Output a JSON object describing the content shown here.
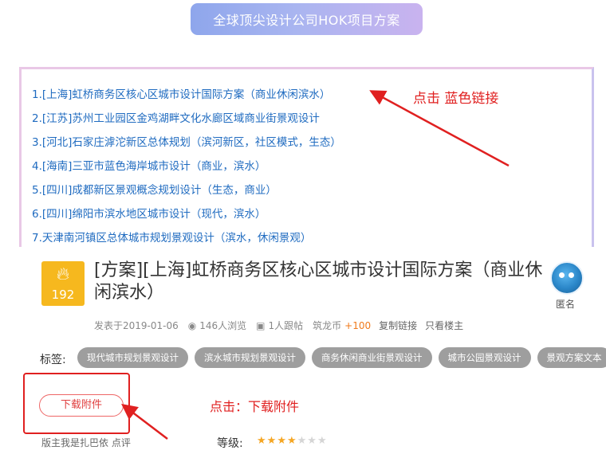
{
  "banner": {
    "title": "全球顶尖设计公司HOK项目方案"
  },
  "links": [
    "1.[上海]虹桥商务区核心区城市设计国际方案（商业休闲滨水）",
    "2.[江苏]苏州工业园区金鸡湖畔文化水廊区域商业街景观设计",
    "3.[河北]石家庄滹沱新区总体规划（滨河新区，社区模式，生态）",
    "4.[海南]三亚市蓝色海岸城市设计（商业，滨水）",
    "5.[四川]成都新区景观概念规划设计（生态，商业）",
    "6.[四川]绵阳市滨水地区城市设计（现代，滨水）",
    "7.天津南河镇区总体城市规划景观设计（滨水，休闲景观）"
  ],
  "annotations": {
    "click_blue_link": "点击  蓝色链接",
    "click_download": "点击：下载附件"
  },
  "post": {
    "heat": "192",
    "title": "[方案][上海]虹桥商务区核心区城市设计国际方案（商业休闲滨水）",
    "author": "匿名",
    "posted": "发表于2019-01-06",
    "views": "146人浏览",
    "follows": "1人跟帖",
    "coin_label": "筑龙币",
    "coin_value": "+100",
    "copy_link": "复制链接",
    "only_author": "只看楼主",
    "tags_label": "标签:",
    "tags": [
      "现代城市规划景观设计",
      "滨水城市规划景观设计",
      "商务休闲商业街景观设计",
      "城市公园景观设计",
      "景观方案文本"
    ],
    "download_label": "下载附件",
    "comment_hint": "版主我是扎巴依 点评",
    "grade_label": "等级:",
    "rating": 4,
    "rating_max": 7
  },
  "colors": {
    "link": "#1f6bc0",
    "annotation": "#e02020",
    "heat_badge": "#f6b81e",
    "tag": "#9e9e9e"
  }
}
